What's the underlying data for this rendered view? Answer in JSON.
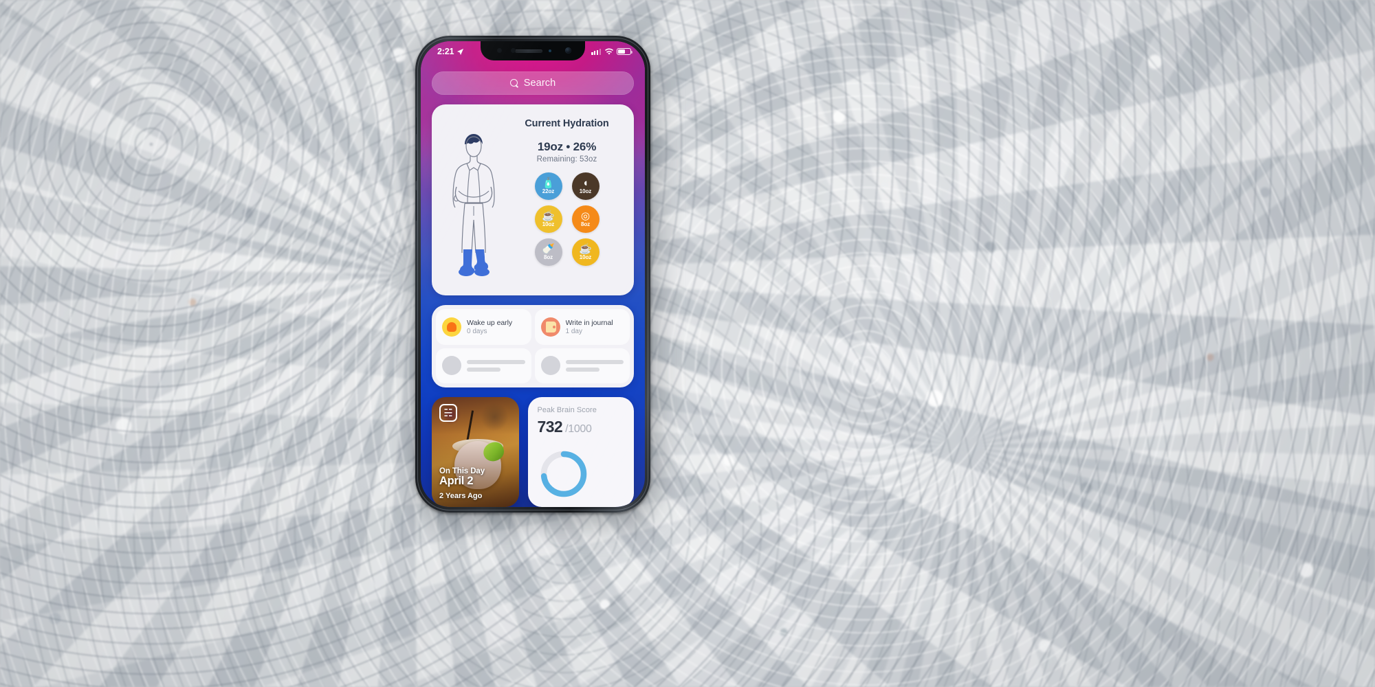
{
  "status_bar": {
    "time": "2:21",
    "location_icon": "location-arrow-icon",
    "cellular_icon": "cellular-signal-icon",
    "wifi_icon": "wifi-icon",
    "battery_icon": "battery-icon",
    "battery_level_pct": 62
  },
  "search": {
    "placeholder": "Search",
    "icon": "search-icon"
  },
  "hydration": {
    "title": "Current Hydration",
    "amount": "19oz • 26%",
    "remaining": "Remaining: 53oz",
    "fill_percent": 26,
    "figure_icon": "person-illustration",
    "beverages": [
      {
        "name": "water-bottle",
        "amount": "22oz",
        "glyph": "🧴",
        "color": "#4a9fd8"
      },
      {
        "name": "coffee-bean",
        "amount": "10oz",
        "glyph": "◖",
        "color": "#4b3828"
      },
      {
        "name": "tea-cup",
        "amount": "10oz",
        "glyph": "☕",
        "color": "#efc02c"
      },
      {
        "name": "citrus-juice",
        "amount": "8oz",
        "glyph": "◎",
        "color": "#f58a18"
      },
      {
        "name": "milk-bottle",
        "amount": "8oz",
        "glyph": "🍼",
        "color": "#bdbdc6"
      },
      {
        "name": "hot-coffee",
        "amount": "10oz",
        "glyph": "☕",
        "color": "#f0b71f"
      }
    ]
  },
  "habits": {
    "items": [
      {
        "name": "Wake up early",
        "streak": "0 days",
        "icon": "sunrise-icon",
        "icon_bg": "#fcd53f",
        "icon_fg": "#f97316"
      },
      {
        "name": "Write in journal",
        "streak": "1 day",
        "icon": "journal-icon",
        "icon_bg": "#f08a6b",
        "icon_fg": "#fbe3a8"
      }
    ],
    "placeholder_count": 2
  },
  "on_this_day": {
    "label": "On This Day",
    "date": "April 2",
    "years_ago": "2 Years Ago",
    "badge_icon": "book-bookmark-icon"
  },
  "brain_score": {
    "title": "Peak Brain Score",
    "score": "732",
    "max": "/1000",
    "value": 732,
    "out_of": 1000,
    "ring_color": "#55b0e3",
    "ring_track_color": "#e4e4ea"
  }
}
